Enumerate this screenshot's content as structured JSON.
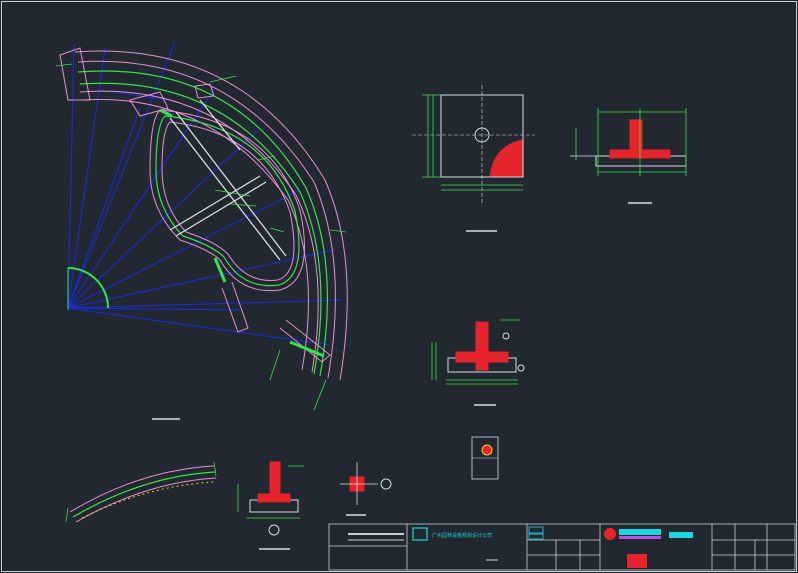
{
  "colors": {
    "background": "#212830",
    "outline_pink": "#e58fd2",
    "rebar_green": "#39e14a",
    "axis_blue": "#1020e6",
    "section_red": "#e5242b",
    "title_cyan": "#18d7e0",
    "linework_white": "#d8dde2"
  },
  "title_block": {
    "company": "广州园林设施规划设计公司"
  },
  "views": {
    "plan": "foundation-plan-fan-shaped",
    "footing_plan": "square-footing-plan",
    "section_wall": "wall-footing-section",
    "section_column": "column-footing-section",
    "detail_strip": "curved-strip-footing",
    "detail_small": "small-column-detail"
  }
}
